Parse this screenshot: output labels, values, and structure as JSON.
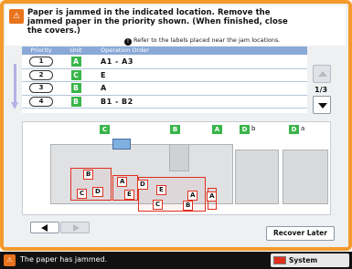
{
  "header": {
    "icon": "paper-jam-icon",
    "message": "Paper is jammed in the indicated location. Remove the jammed paper in the priority shown. (When finished, close the covers.)",
    "hint": "Refer to the labels placed near the jam locations."
  },
  "table": {
    "columns": [
      "Priority",
      "Unit",
      "Operation Order"
    ],
    "rows": [
      {
        "priority": "1",
        "unit": "A",
        "order": "A1 - A3"
      },
      {
        "priority": "2",
        "unit": "C",
        "order": "E"
      },
      {
        "priority": "3",
        "unit": "B",
        "order": "A"
      },
      {
        "priority": "4",
        "unit": "B",
        "order": "B1 - B2"
      }
    ]
  },
  "pager": {
    "text": "1/3"
  },
  "diagram": {
    "top_labels": [
      {
        "text": "C"
      },
      {
        "text": "B"
      },
      {
        "text": "A"
      },
      {
        "text": "D",
        "suffix": "b"
      },
      {
        "text": "D",
        "suffix": "a"
      }
    ],
    "jam_labels": [
      "B",
      "A",
      "D",
      "C",
      "D",
      "E",
      "E",
      "A",
      "C",
      "B",
      "A"
    ]
  },
  "buttons": {
    "recover_later": "Recover Later"
  },
  "status": {
    "text": "The paper has jammed.",
    "system_monitor": "System Monitor"
  },
  "colors": {
    "accent": "#f39a2b",
    "unit_green": "#39b54a",
    "jam_red": "#e0301e",
    "table_header": "#8aa9d8"
  }
}
